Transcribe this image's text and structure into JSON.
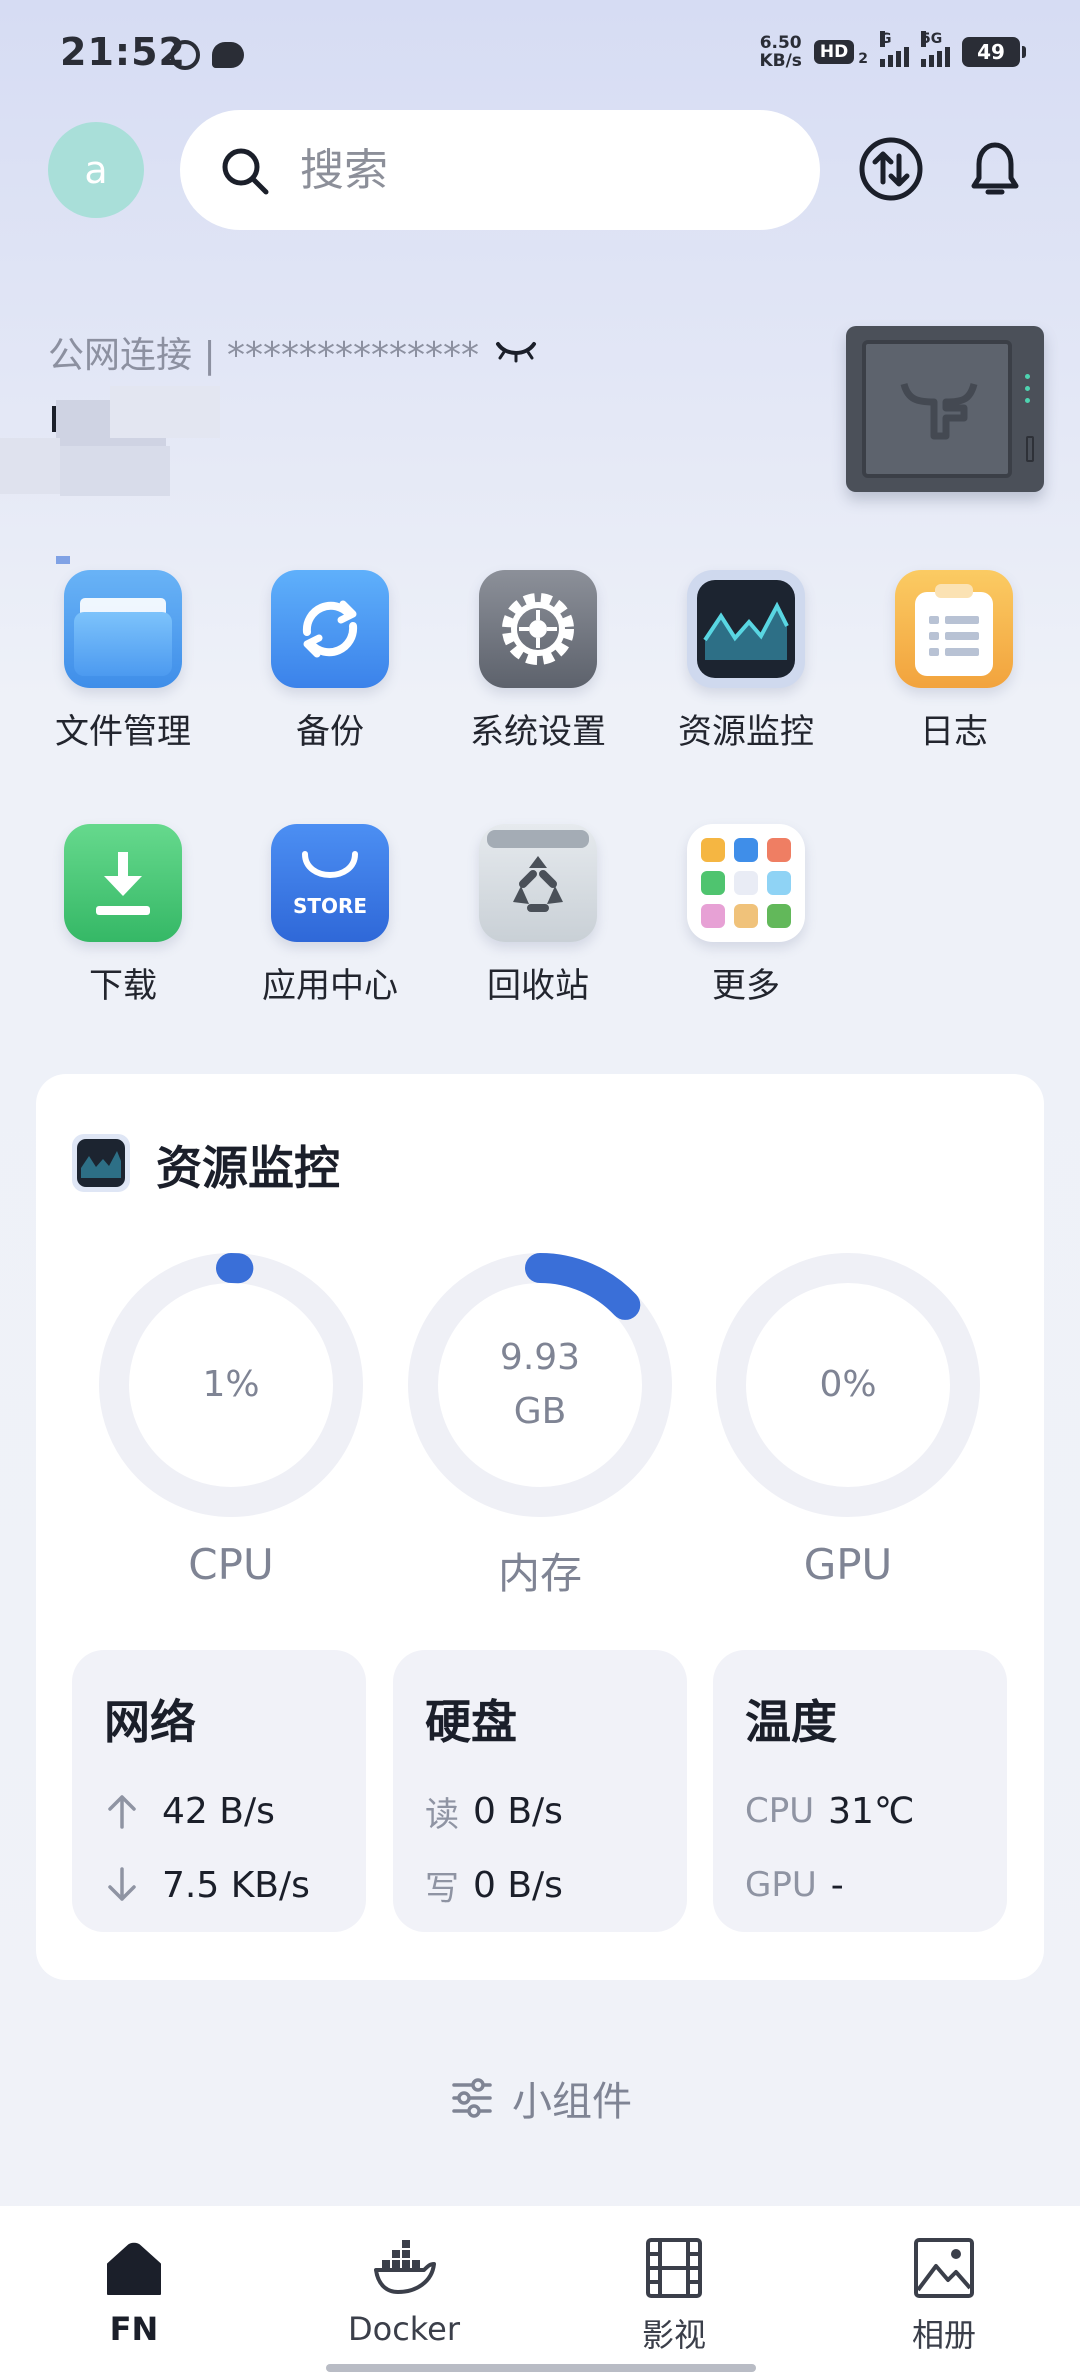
{
  "status_bar": {
    "time": "21:52",
    "net_speed_value": "6.50",
    "net_speed_unit": "KB/s",
    "hd_label": "HD",
    "hd_sub": "2",
    "signal_1_label": "G",
    "signal_2_label": "5G",
    "battery": "49"
  },
  "header": {
    "avatar_letter": "a",
    "search_placeholder": "搜索"
  },
  "connection": {
    "label": "公网连接 | **************"
  },
  "apps": [
    {
      "label": "文件管理"
    },
    {
      "label": "备份"
    },
    {
      "label": "系统设置"
    },
    {
      "label": "资源监控"
    },
    {
      "label": "日志"
    },
    {
      "label": "下载"
    },
    {
      "label": "应用中心",
      "badge": "STORE"
    },
    {
      "label": "回收站"
    },
    {
      "label": "更多"
    }
  ],
  "monitor": {
    "title": "资源监控",
    "gauges": [
      {
        "label": "CPU",
        "value": "1%",
        "fraction": 0.01
      },
      {
        "label": "内存",
        "value_line1": "9.93",
        "value_line2": "GB",
        "fraction": 0.13
      },
      {
        "label": "GPU",
        "value": "0%",
        "fraction": 0
      }
    ],
    "network": {
      "title": "网络",
      "up": "42 B/s",
      "down": "7.5 KB/s"
    },
    "disk": {
      "title": "硬盘",
      "read_key": "读",
      "read": "0 B/s",
      "write_key": "写",
      "write": "0 B/s"
    },
    "temp": {
      "title": "温度",
      "cpu_key": "CPU",
      "cpu": "31℃",
      "gpu_key": "GPU",
      "gpu": "-"
    }
  },
  "widgets_link": "小组件",
  "bottom_nav": [
    {
      "label": "FN",
      "active": true
    },
    {
      "label": "Docker"
    },
    {
      "label": "影视"
    },
    {
      "label": "相册"
    }
  ],
  "colors": {
    "accent": "#3a6fd8",
    "gauge_track": "#eff0f6"
  }
}
